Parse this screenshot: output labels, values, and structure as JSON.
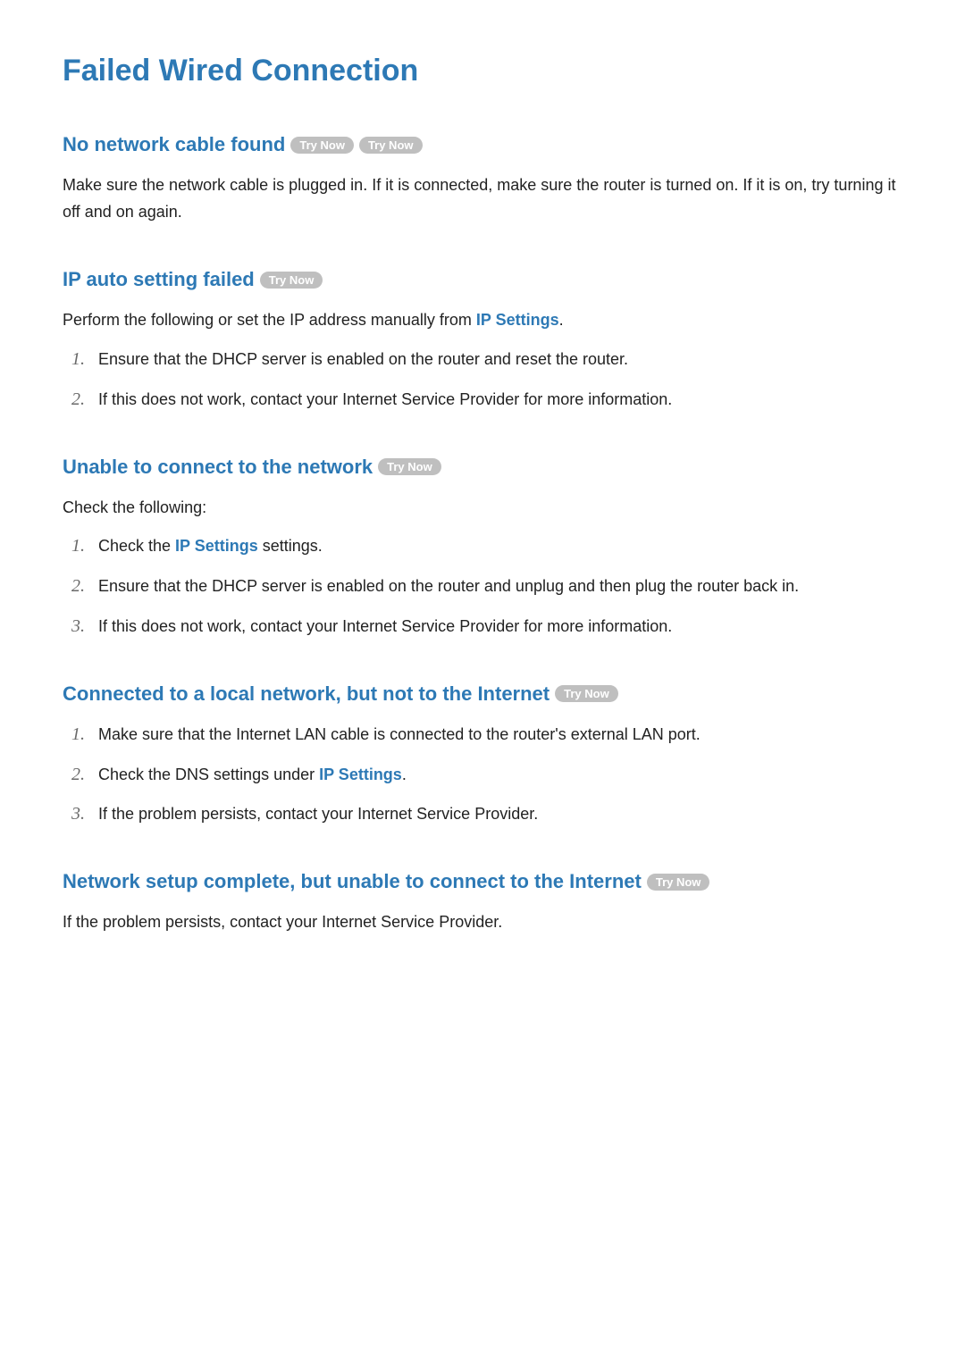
{
  "palette": {
    "heading_blue": "#2d79b5",
    "try_now_bg": "#bfbfbf",
    "try_now_fg": "#ffffff",
    "body_text": "#222222",
    "list_num": "#6a6a6a"
  },
  "labels": {
    "try_now": "Try Now",
    "ip_settings": "IP Settings"
  },
  "title": "Failed Wired Connection",
  "sections": {
    "no_cable": {
      "heading": "No network cable found",
      "try_now_count": 2,
      "body": "Make sure the network cable is plugged in. If it is connected, make sure the router is turned on. If it is on, try turning it off and on again."
    },
    "ip_auto": {
      "heading": "IP auto setting failed",
      "try_now_count": 1,
      "intro_pre": "Perform the following or set the IP address manually from ",
      "intro_post": ".",
      "items": [
        "Ensure that the DHCP server is enabled on the router and reset the router.",
        "If this does not work, contact your Internet Service Provider for more information."
      ]
    },
    "unable_connect": {
      "heading": "Unable to connect to the network",
      "try_now_count": 1,
      "intro": "Check the following:",
      "item1_pre": "Check the ",
      "item1_post": " settings.",
      "item2": "Ensure that the DHCP server is enabled on the router and unplug and then plug the router back in.",
      "item3": "If this does not work, contact your Internet Service Provider for more information."
    },
    "local_not_internet": {
      "heading": "Connected to a local network, but not to the Internet",
      "try_now_count": 1,
      "item1": "Make sure that the Internet LAN cable is connected to the router's external LAN port.",
      "item2_pre": "Check the DNS settings under ",
      "item2_post": ".",
      "item3": "If the problem persists, contact your Internet Service Provider."
    },
    "setup_complete": {
      "heading": "Network setup complete, but unable to connect to the Internet",
      "try_now_count": 1,
      "body": "If the problem persists, contact your Internet Service Provider."
    }
  }
}
